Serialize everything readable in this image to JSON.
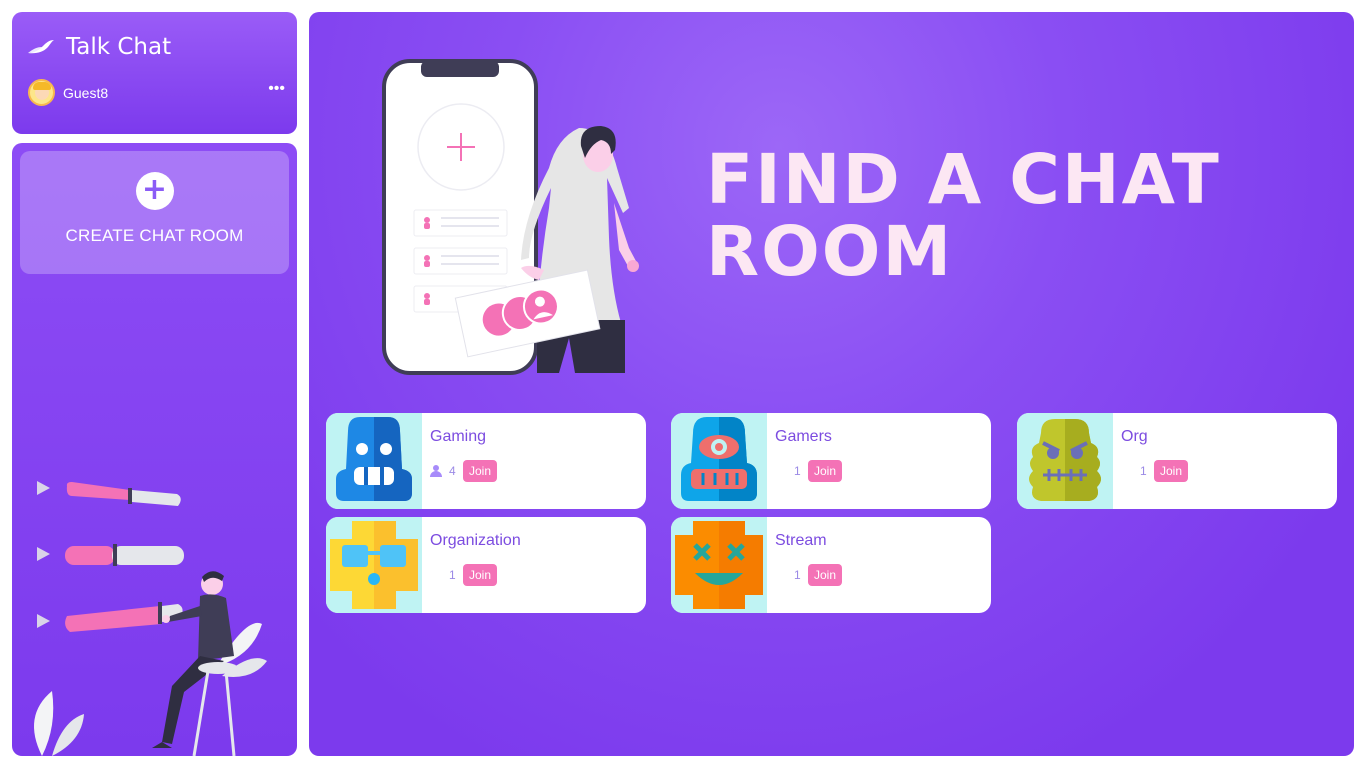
{
  "app": {
    "title": "Talk Chat",
    "user": {
      "name": "Guest8"
    },
    "more_label": "•••"
  },
  "sidebar": {
    "create_label": "CREATE CHAT ROOM",
    "create_icon": "plus-icon"
  },
  "hero": {
    "title": "FIND A CHAT ROOM"
  },
  "rooms": [
    {
      "name": "Gaming",
      "members": "4",
      "join": "Join",
      "icon": "blue-robot-icon"
    },
    {
      "name": "Gamers",
      "members": "1",
      "join": "Join",
      "icon": "cyclops-robot-icon"
    },
    {
      "name": "Org",
      "members": "1",
      "join": "Join",
      "icon": "green-monster-icon"
    },
    {
      "name": "Organization",
      "members": "1",
      "join": "Join",
      "icon": "yellow-glasses-icon"
    },
    {
      "name": "Stream",
      "members": "1",
      "join": "Join",
      "icon": "orange-xx-face-icon"
    }
  ],
  "colors": {
    "accent": "#7c3aed",
    "join": "#f472b6",
    "thumb_bg": "#bff3f3"
  }
}
